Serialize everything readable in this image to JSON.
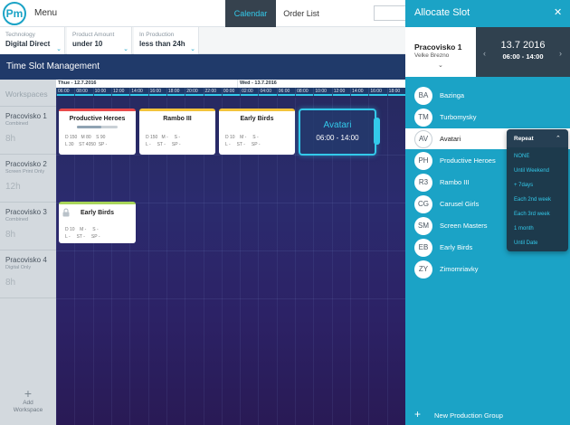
{
  "app": {
    "logo": "Pm",
    "menu_label": "Menu"
  },
  "nav": {
    "tabs": [
      {
        "label": "Calendar",
        "active": true
      },
      {
        "label": "Order List",
        "active": false
      }
    ]
  },
  "filters": [
    {
      "label": "Technology",
      "value": "Digital Direct"
    },
    {
      "label": "Product Amount",
      "value": "under 10"
    },
    {
      "label": "In Production",
      "value": "less than 24h"
    }
  ],
  "main": {
    "title": "Time Slot Management",
    "workspaces_label": "Workspaces",
    "add_workspace": "Add\nWorkspace"
  },
  "workspaces": [
    {
      "name": "Pracovisko 1",
      "type": "Combined",
      "capacity": "8h"
    },
    {
      "name": "Pracovisko 2",
      "type": "Screen Print Only",
      "capacity": "12h"
    },
    {
      "name": "Pracovisko 3",
      "type": "Combined",
      "capacity": "8h"
    },
    {
      "name": "Pracovisko 4",
      "type": "Digital Only",
      "capacity": "8h"
    }
  ],
  "timeline": {
    "days": [
      "Thue - 12.7.2016",
      "Wed - 13.7.2016"
    ],
    "hours": [
      "06:00",
      "08:00",
      "10:00",
      "12:00",
      "14:00",
      "16:00",
      "18:00",
      "20:00",
      "22:00",
      "00:00",
      "02:00",
      "04:00",
      "06:00",
      "08:00",
      "10:00",
      "12:00",
      "14:00",
      "16:00",
      "18:00"
    ]
  },
  "cards": [
    {
      "title": "Productive Heroes",
      "stats": "D 150   M 80    S 90\nL 30    ST 4050  SP -",
      "progress": 0.6,
      "accent": "#e84b4b"
    },
    {
      "title": "Rambo III",
      "stats": "D 150   M -     S -\nL -     ST -     SP -",
      "accent": "#f3c33b"
    },
    {
      "title": "Early Birds",
      "stats": "D 10    M -     S -\nL -     ST -     SP -",
      "accent": "#f3c33b"
    },
    {
      "title": "Early Birds",
      "stats": "D 10    M -     S -\nL -     ST -     SP -",
      "accent": "#a8d55a"
    }
  ],
  "active_slot": {
    "title": "Avatari",
    "time": "06:00 - 14:00"
  },
  "panel": {
    "title": "Allocate Slot",
    "close": "✕",
    "workspace": "Pracovisko 1",
    "location": "Velke Brezno",
    "date": "13.7 2016",
    "time": "06:00 - 14:00"
  },
  "groups": [
    {
      "initials": "BA",
      "name": "Bazinga"
    },
    {
      "initials": "TM",
      "name": "Turbomysky"
    },
    {
      "initials": "AV",
      "name": "Avatari",
      "selected": true
    },
    {
      "initials": "PH",
      "name": "Productive Heroes"
    },
    {
      "initials": "R3",
      "name": "Rambo III"
    },
    {
      "initials": "CG",
      "name": "Carusel Girls"
    },
    {
      "initials": "SM",
      "name": "Screen Masters"
    },
    {
      "initials": "EB",
      "name": "Early Birds"
    },
    {
      "initials": "ZY",
      "name": "Zimomriavky"
    }
  ],
  "repeat": {
    "title": "Repeat",
    "options": [
      "NONE",
      "Until Weekend",
      "+ 7days",
      "Each 2nd week",
      "Each 3rd week",
      "1 month",
      "Until Date"
    ]
  },
  "new_group": "New Production Group",
  "colors": {
    "accent": "#1ba3c6",
    "highlight": "#33c9ea",
    "dark": "#30414f"
  }
}
